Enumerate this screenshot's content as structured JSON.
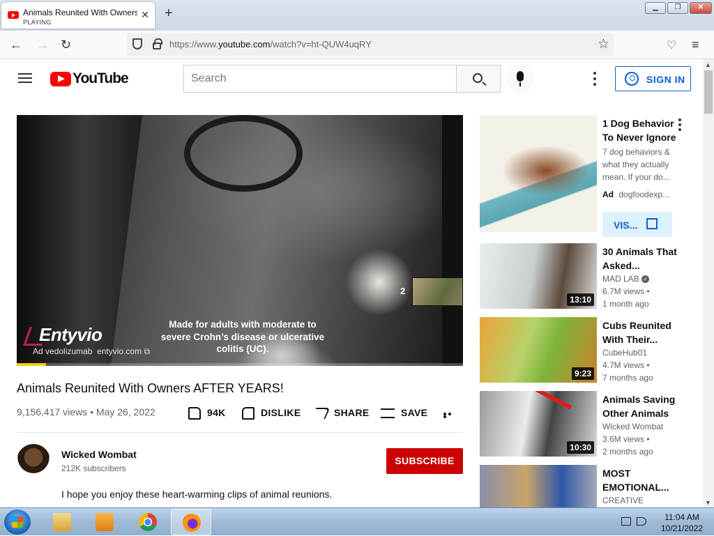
{
  "browser": {
    "tab_title": "Animals Reunited With Owners AFTER YEARS!",
    "tab_status": "PLAYING",
    "url_prefix": "https://www.",
    "url_domain": "youtube.com",
    "url_path": "/watch?v=ht-QUW4uqRY",
    "window_buttons": [
      "minimize",
      "maximize",
      "close"
    ]
  },
  "youtube": {
    "logo_text": "YouTube",
    "search_placeholder": "Search",
    "sign_in_label": "SIGN IN"
  },
  "player": {
    "queue_count": "2",
    "ad_brand": "Entyvio",
    "ad_label": "Ad",
    "ad_extra": "vedolizumab",
    "ad_domain": "entyvio.com",
    "ad_message": "Made for adults with moderate to severe Crohn’s disease or ulcerative colitis (UC).",
    "progress_fraction": 0.065,
    "progress_color": "#ffcc00"
  },
  "video": {
    "title": "Animals Reunited With Owners AFTER YEARS!",
    "meta": "9,156,417 views • May 26, 2022",
    "like_count": "94K",
    "dislike_label": "DISLIKE",
    "share_label": "SHARE",
    "save_label": "SAVE"
  },
  "channel": {
    "name": "Wicked Wombat",
    "subscribers": "212K subscribers",
    "subscribe_label": "SUBSCRIBE",
    "description": "I hope you enjoy these heart-warming clips of animal reunions."
  },
  "sidebar": {
    "ad": {
      "title": "1 Dog Behavior To Never Ignore",
      "description": "7 dog behaviors & what they actually mean. If your do...",
      "ad_badge": "Ad",
      "ad_domain": "dogfoodexp...",
      "cta_label": "VIS..."
    },
    "items": [
      {
        "title": "30 Animals That Asked...",
        "channel": "MAD LAB",
        "verified": true,
        "views": "6.7M views •",
        "age": "1 month ago",
        "duration": "13:10"
      },
      {
        "title": "Cubs Reunited With Their...",
        "channel": "CubeHub01",
        "views": "4.7M views •",
        "age": "7 months ago",
        "duration": "9:23"
      },
      {
        "title": "Animals Saving Other Animals",
        "channel": "Wicked Wombat",
        "views": "3.6M views •",
        "age": "2 months ago",
        "duration": "10:30"
      },
      {
        "title": "MOST EMOTIONAL...",
        "channel": "CREATIVE"
      }
    ]
  },
  "taskbar": {
    "time": "11:04 AM",
    "date": "10/21/2022",
    "apps": [
      "windows-explorer",
      "media-player",
      "chrome",
      "firefox"
    ]
  }
}
